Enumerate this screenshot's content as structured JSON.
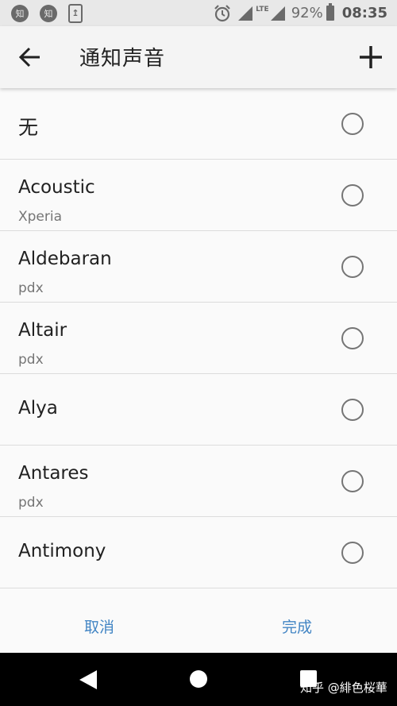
{
  "status_bar": {
    "notif1": "知",
    "notif2": "知",
    "network": "LTE",
    "battery": "92%",
    "time": "08:35"
  },
  "header": {
    "title": "通知声音",
    "back_icon": "arrow-left-icon",
    "add_icon": "plus-icon"
  },
  "ringtones": [
    {
      "title": "无",
      "subtitle": ""
    },
    {
      "title": "Acoustic",
      "subtitle": "Xperia"
    },
    {
      "title": "Aldebaran",
      "subtitle": "pdx"
    },
    {
      "title": "Altair",
      "subtitle": "pdx"
    },
    {
      "title": "Alya",
      "subtitle": ""
    },
    {
      "title": "Antares",
      "subtitle": "pdx"
    },
    {
      "title": "Antimony",
      "subtitle": ""
    }
  ],
  "footer": {
    "cancel_label": "取消",
    "done_label": "完成"
  },
  "watermark": "知乎 @緋色桜華",
  "colors": {
    "accent": "#4285c4",
    "status_bar_bg": "#e8e8e8",
    "nav_bar_bg": "#000000"
  }
}
